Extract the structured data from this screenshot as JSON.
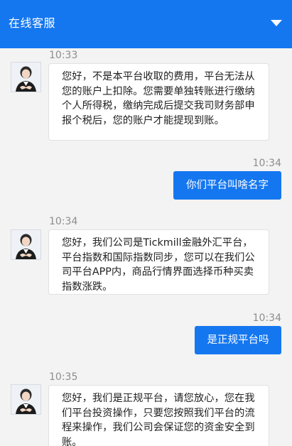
{
  "header": {
    "title": "在线客服",
    "dropdown_icon": "triangle-down-icon"
  },
  "messages": [
    {
      "side": "agent",
      "time": "10:33",
      "text": "您好，不是本平台收取的费用，平台无法从您的账户上扣除。您需要单独转账进行缴纳个人所得税，缴纳完成后提交我司财务部申报个税后，您的账户才能提现到账。"
    },
    {
      "side": "user",
      "time": "10:34",
      "text": "你们平台叫啥名字"
    },
    {
      "side": "agent",
      "time": "10:34",
      "text": "您好，我们公司是Tickmill金融外汇平台，平台指数和国际指数同步，您可以在我们公司平台APP内，商品行情界面选择币种买卖指数涨跌。"
    },
    {
      "side": "user",
      "time": "10:34",
      "text": "是正规平台吗"
    },
    {
      "side": "agent",
      "time": "10:35",
      "text": "您好，我们是正规平台，请您放心，您在我们平台投资操作，只要您按照我们平台的流程来操作，我们公司会保证您的资金安全到账。"
    }
  ],
  "colors": {
    "accent": "#1577f0",
    "background": "#f3f3f3",
    "bubble_in": "#ffffff",
    "timestamp": "#8d8d8d"
  }
}
